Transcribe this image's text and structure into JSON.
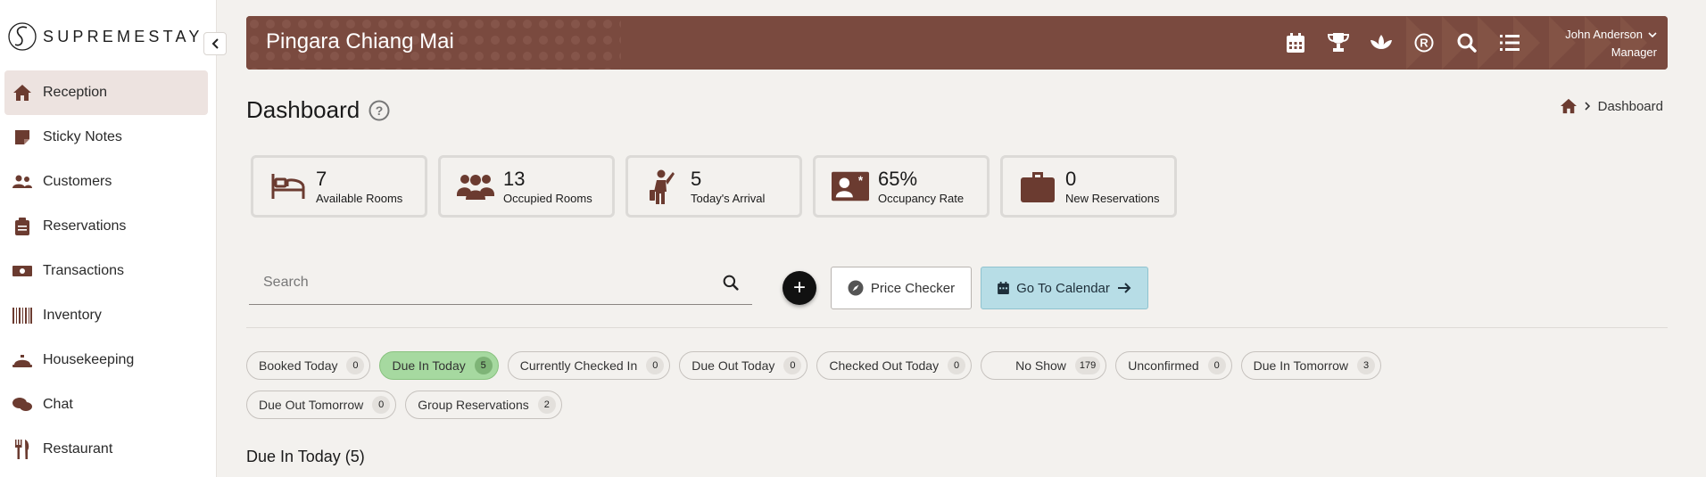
{
  "brand": {
    "logo_text": "SUPREMESTAY"
  },
  "sidebar": {
    "items": [
      {
        "label": "Reception",
        "icon": "home-icon",
        "active": true
      },
      {
        "label": "Sticky Notes",
        "icon": "sticky-note-icon"
      },
      {
        "label": "Customers",
        "icon": "users-icon"
      },
      {
        "label": "Reservations",
        "icon": "clipboard-icon"
      },
      {
        "label": "Transactions",
        "icon": "money-icon"
      },
      {
        "label": "Inventory",
        "icon": "barcode-icon"
      },
      {
        "label": "Housekeeping",
        "icon": "bell-service-icon"
      },
      {
        "label": "Chat",
        "icon": "chat-icon"
      },
      {
        "label": "Restaurant",
        "icon": "utensils-icon"
      }
    ]
  },
  "header": {
    "hotel_name": "Pingara Chiang Mai",
    "icons": [
      "calendar-icon",
      "trophy-icon",
      "lotus-icon",
      "registered-icon",
      "search-icon",
      "list-icon"
    ],
    "user": {
      "name": "John Anderson",
      "role": "Manager"
    }
  },
  "page": {
    "title": "Dashboard",
    "breadcrumb": "Dashboard"
  },
  "stats": [
    {
      "value": "7",
      "label": "Available Rooms",
      "icon": "bed-icon"
    },
    {
      "value": "13",
      "label": "Occupied Rooms",
      "icon": "group-icon"
    },
    {
      "value": "5",
      "label": "Today's Arrival",
      "icon": "person-arrival-icon"
    },
    {
      "value": "65%",
      "label": "Occupancy Rate",
      "icon": "id-card-icon"
    },
    {
      "value": "0",
      "label": "New Reservations",
      "icon": "briefcase-icon"
    }
  ],
  "search": {
    "placeholder": "Search",
    "value": ""
  },
  "actions": {
    "add_label": "+",
    "price_checker": "Price Checker",
    "go_to_calendar": "Go To Calendar"
  },
  "filters": [
    {
      "label": "Booked Today",
      "count": "0"
    },
    {
      "label": "Due In Today",
      "count": "5",
      "active": true
    },
    {
      "label": "Currently Checked In",
      "count": "0"
    },
    {
      "label": "Due Out Today",
      "count": "0"
    },
    {
      "label": "Checked Out Today",
      "count": "0"
    },
    {
      "label": "No Show",
      "count": "179"
    },
    {
      "label": "Unconfirmed",
      "count": "0"
    },
    {
      "label": "Due In Tomorrow",
      "count": "3"
    },
    {
      "label": "Due Out Tomorrow",
      "count": "0"
    },
    {
      "label": "Group Reservations",
      "count": "2"
    }
  ],
  "section": {
    "title": "Due In Today (5)"
  },
  "colors": {
    "brand_brown": "#7a4a3f",
    "icon_brown": "#6b3b30",
    "active_chip": "#a6d9a0",
    "calendar_button": "#b7dde6"
  }
}
